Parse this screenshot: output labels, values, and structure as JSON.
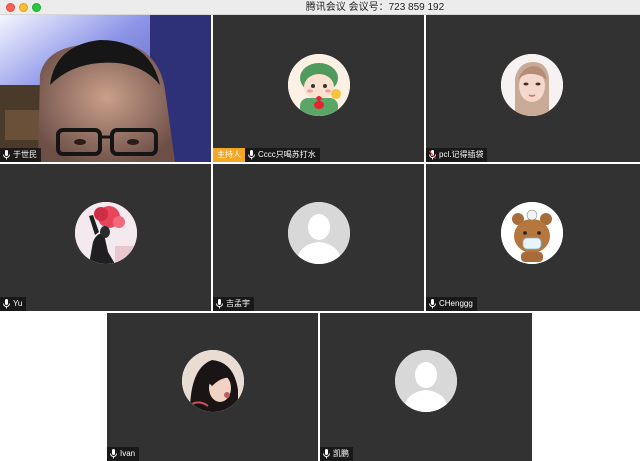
{
  "window": {
    "title": "腾讯会议 会议号：723 859 192"
  },
  "participants": [
    {
      "name": "于世民",
      "host": false,
      "video": true,
      "avatar": "camera-video"
    },
    {
      "name": "Cccc只喝苏打水",
      "host": true,
      "host_label": "主持人",
      "video": false,
      "avatar": "cartoon-dinosaur-avatar"
    },
    {
      "name": "pcl.记得插袋",
      "host": false,
      "video": false,
      "avatar": "girl-photo-avatar"
    },
    {
      "name": "Yu",
      "host": false,
      "video": false,
      "avatar": "red-flower-photo-avatar"
    },
    {
      "name": "吉孟宇",
      "host": false,
      "video": false,
      "avatar": "default-person-avatar"
    },
    {
      "name": "CHenggg",
      "host": false,
      "video": false,
      "avatar": "brown-bear-avatar"
    },
    {
      "name": "Ivan",
      "host": false,
      "video": false,
      "avatar": "dark-portrait-avatar"
    },
    {
      "name": "凯鹏",
      "host": false,
      "video": false,
      "avatar": "default-person-avatar"
    }
  ],
  "colors": {
    "tile_bg": "#333233",
    "host_tag": "#f5a623",
    "default_avatar_bg": "#d7d7d7"
  }
}
